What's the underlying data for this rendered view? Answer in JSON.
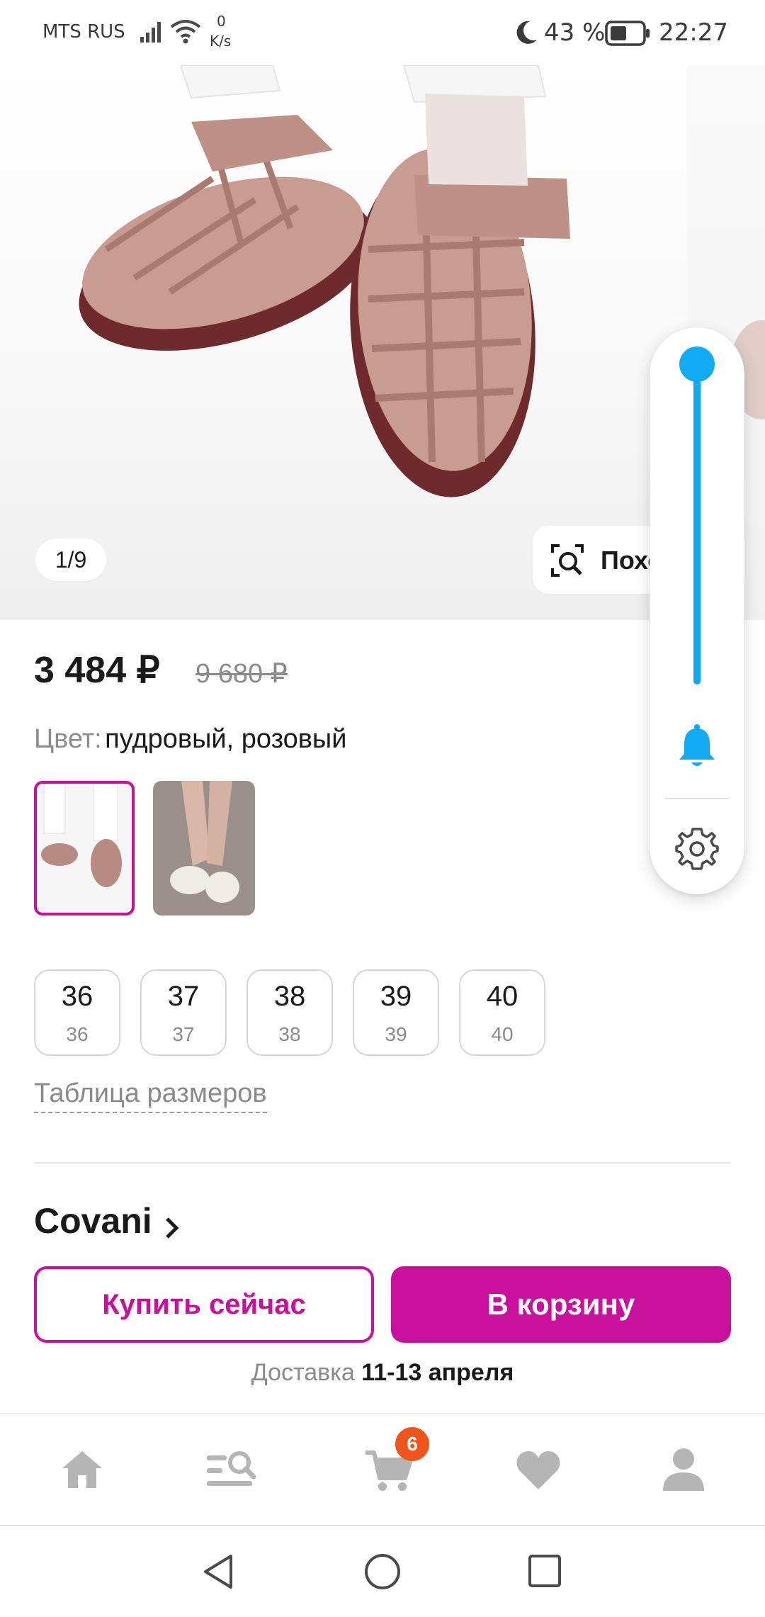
{
  "status_bar": {
    "carrier": "MTS RUS",
    "net_speed_value": "0",
    "net_speed_unit": "K/s",
    "battery": "43 %",
    "time": "22:27"
  },
  "gallery": {
    "counter": "1/9",
    "similar_label": "Похожие"
  },
  "product": {
    "price": "3 484 ₽",
    "old_price": "9 680 ₽",
    "color_label": "Цвет:",
    "color_value": "пудровый, розовый",
    "sizes": [
      {
        "main": "36",
        "sub": "36"
      },
      {
        "main": "37",
        "sub": "37"
      },
      {
        "main": "38",
        "sub": "38"
      },
      {
        "main": "39",
        "sub": "39"
      },
      {
        "main": "40",
        "sub": "40"
      }
    ],
    "size_table_link": "Таблица размеров",
    "brand": "Covani"
  },
  "actions": {
    "buy_now": "Купить сейчас",
    "add_to_cart": "В корзину",
    "delivery_label": "Доставка",
    "delivery_dates": "11-13 апреля"
  },
  "bottom_nav": {
    "cart_badge": "6",
    "items": [
      "home-icon",
      "catalog-search-icon",
      "cart-icon",
      "heart-icon",
      "profile-icon"
    ]
  },
  "volume_panel": {
    "level": 1.0
  },
  "colors": {
    "accent": "#c8109d",
    "badge": "#f0561c",
    "volume": "#10a9f2"
  }
}
